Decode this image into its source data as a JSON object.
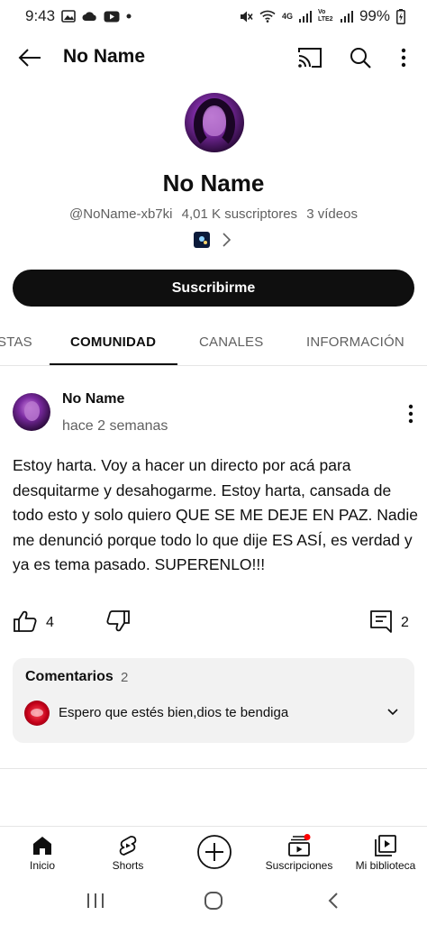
{
  "status_bar": {
    "time": "9:43",
    "battery": "99%",
    "network_label": "4G",
    "volte_label": "Vo LTE2"
  },
  "app_bar": {
    "title": "No Name",
    "back_icon": "arrow-left-icon",
    "cast_icon": "cast-icon",
    "search_icon": "search-icon",
    "more_icon": "more-vertical-icon"
  },
  "channel": {
    "name": "No Name",
    "handle": "@NoName-xb7ki",
    "subscribers": "4,01 K suscriptores",
    "videos": "3 vídeos",
    "subscribe_label": "Suscribirme"
  },
  "tabs": [
    {
      "label": "STAS"
    },
    {
      "label": "COMUNIDAD",
      "active": true
    },
    {
      "label": "CANALES"
    },
    {
      "label": "INFORMACIÓN"
    }
  ],
  "post": {
    "author": "No Name",
    "time": "hace 2 semanas",
    "text": "Estoy harta. Voy a hacer un directo por acá para desquitarme y desahogarme. Estoy harta, cansada de todo esto y solo quiero QUE SE ME DEJE EN PAZ. Nadie me denunció porque todo lo que dije ES ASÍ, es verdad y ya es tema pasado. SUPERENLO!!!",
    "likes": "4",
    "comments": "2"
  },
  "comments": {
    "title": "Comentarios",
    "count": "2",
    "top_comment": "Espero que estés bien,dios te bendiga"
  },
  "bottom_nav": [
    {
      "label": "Inicio",
      "icon": "home-icon"
    },
    {
      "label": "Shorts",
      "icon": "shorts-icon"
    },
    {
      "label": "Suscripciones",
      "icon": "subscriptions-icon"
    },
    {
      "label": "Mi biblioteca",
      "icon": "library-icon"
    }
  ],
  "colors": {
    "text_primary": "#0f0f0f",
    "text_secondary": "#606060",
    "notification_dot": "#ff0000",
    "card_background": "#f2f2f2"
  }
}
